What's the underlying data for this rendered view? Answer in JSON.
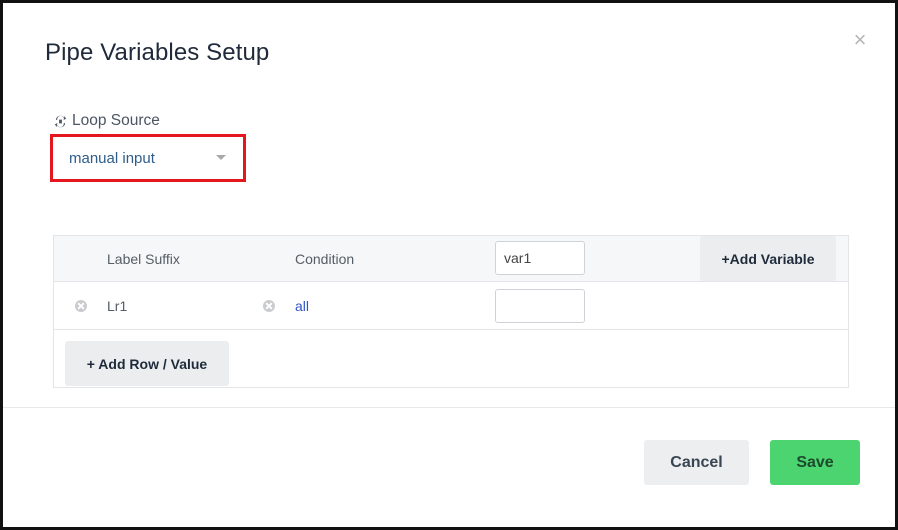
{
  "dialog": {
    "title": "Pipe Variables Setup",
    "close_glyph": "×"
  },
  "loop_source": {
    "label": "Loop Source",
    "icon": "loop-icon",
    "selected": "manual input",
    "highlight_color": "#e3171d"
  },
  "table": {
    "headers": {
      "label_suffix": "Label Suffix",
      "condition": "Condition"
    },
    "variable_input_value": "var1",
    "add_variable_label": "+Add Variable",
    "rows": [
      {
        "label": "Lr1",
        "condition": "all",
        "value": ""
      }
    ],
    "add_row_label": "+ Add Row / Value"
  },
  "footer": {
    "cancel_label": "Cancel",
    "save_label": "Save"
  },
  "colors": {
    "save": "#4cd471",
    "link": "#2f56c6"
  }
}
